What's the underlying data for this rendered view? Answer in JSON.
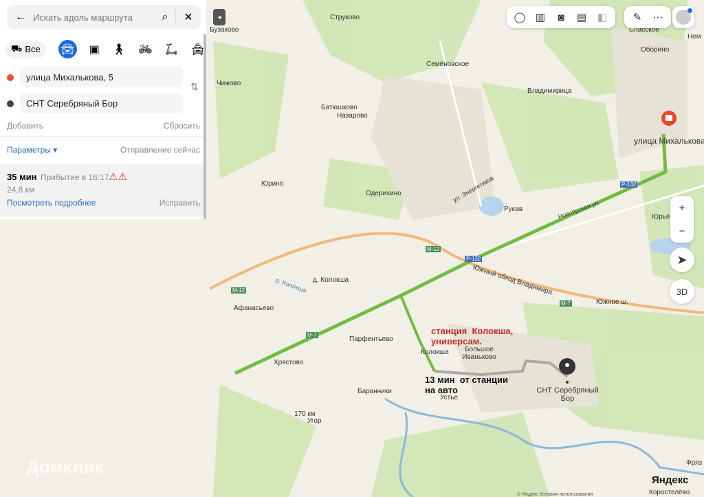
{
  "search": {
    "placeholder": "Искать вдоль маршрута"
  },
  "modes": {
    "all_label": "Все"
  },
  "route_points": {
    "from": "улица Михалькова, 5",
    "to": "СНТ Серебряный Бор"
  },
  "actions": {
    "add": "Добавить",
    "reset": "Сбросить",
    "params": "Параметры ▾",
    "departure": "Отправление сейчас"
  },
  "route": {
    "duration": "35 мин",
    "arrival": "Прибытие в 16:17",
    "distance": "24,8 км",
    "details": "Посмотреть подробнее",
    "fix": "Исправить"
  },
  "map": {
    "zoom_3d": "3D",
    "brand": "Яндекс",
    "watermark": "Домклик",
    "copyright": "© Яндекс  Условия использования",
    "labels": [
      "Струково",
      "Бузаково",
      "Спасское",
      "Оборино",
      "Нем",
      "Семёновское",
      "Чижово",
      "Владимирица",
      "Батюшково",
      "Назарово",
      "улица Михалькова",
      "Юрино",
      "Одерихино",
      "Рукав",
      "ул. Энергетиков",
      "Новоярская ул.",
      "Юрьев",
      "М-12",
      "Р-132",
      "д. Колокша",
      "Южный обход Владимира",
      "Южное ш.",
      "Афанасьево",
      "М-7",
      "Парфентьево",
      "Колокша",
      "Большое Иваньково",
      "Хрястово",
      "Устье",
      "Баранники",
      "170 км",
      "Угор",
      "СНТ Серебряный Бор",
      "Фряз",
      "Коростелёво",
      "р. Колокша",
      "М-12",
      "М-7",
      "Р-132"
    ]
  },
  "annotations": {
    "station": "станция  Колокша,\nуниверсам.",
    "time": "13 мин  от станции\nна авто"
  },
  "colors": {
    "accent": "#1d6ae5",
    "route_green": "#6fbe3e",
    "annotation_red": "#d32b2b"
  }
}
